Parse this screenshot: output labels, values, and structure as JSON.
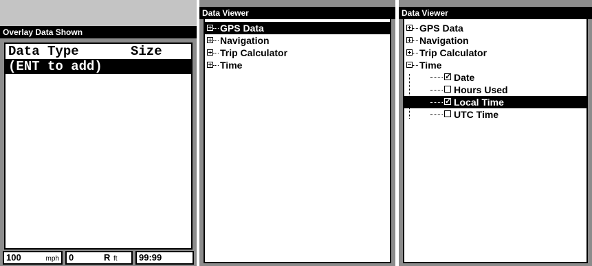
{
  "screen1": {
    "title": "Overlay Data Shown",
    "list": {
      "header_type": "Data Type",
      "header_size": "Size",
      "add_item": "(ENT to add)"
    },
    "status": {
      "speed_value": "100",
      "speed_unit": "mph",
      "field2_value": "0",
      "field2_mid": "R",
      "field2_unit": "ft",
      "time_value": "99:99"
    }
  },
  "screen2": {
    "title": "Data Viewer",
    "tree": [
      {
        "label": "GPS Data",
        "expanded": false,
        "selected": true
      },
      {
        "label": "Navigation",
        "expanded": false,
        "selected": false
      },
      {
        "label": "Trip Calculator",
        "expanded": false,
        "selected": false
      },
      {
        "label": "Time",
        "expanded": false,
        "selected": false
      }
    ]
  },
  "screen3": {
    "title": "Data Viewer",
    "tree": [
      {
        "label": "GPS Data",
        "expanded": false
      },
      {
        "label": "Navigation",
        "expanded": false
      },
      {
        "label": "Trip Calculator",
        "expanded": false
      },
      {
        "label": "Time",
        "expanded": true
      }
    ],
    "children": [
      {
        "label": "Date",
        "checked": true,
        "selected": false
      },
      {
        "label": "Hours Used",
        "checked": false,
        "selected": false
      },
      {
        "label": "Local Time",
        "checked": true,
        "selected": true
      },
      {
        "label": "UTC Time",
        "checked": false,
        "selected": false
      }
    ]
  }
}
